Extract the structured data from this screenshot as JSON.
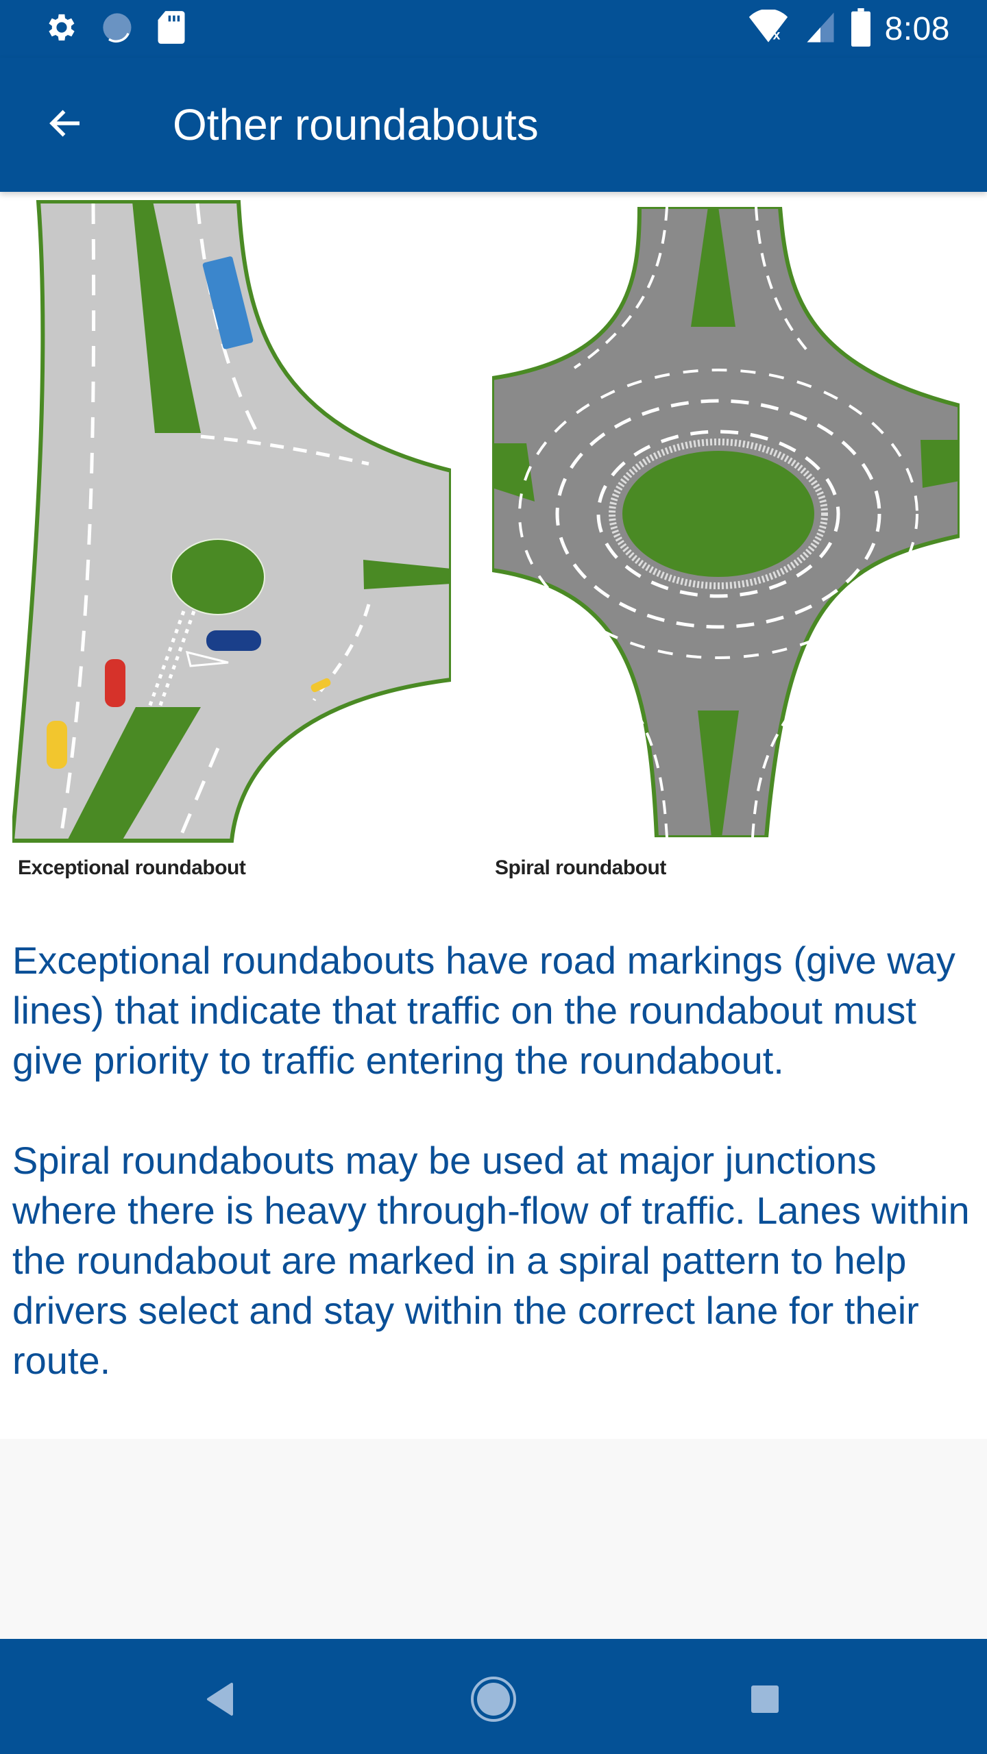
{
  "status_bar": {
    "left_icons": [
      "gear-icon",
      "sync-progress-icon",
      "sd-card-icon"
    ],
    "right_icons": [
      "wifi-off-icon",
      "cell-signal-icon",
      "battery-icon"
    ],
    "time": "8:08"
  },
  "app_bar": {
    "back_icon": "arrow-back-icon",
    "title": "Other roundabouts"
  },
  "figure": {
    "left_caption": "Exceptional roundabout",
    "right_caption": "Spiral roundabout"
  },
  "body": {
    "paragraphs": [
      "Exceptional roundabouts have road markings (give way lines) that indicate that traffic on the roundabout must give priority to traffic entering the roundabout.",
      "Spiral roundabouts may be used at major junctions where there is heavy through-flow of traffic. Lanes within the roundabout are marked in a spiral pattern to help drivers select and stay within the correct lane for their route."
    ]
  },
  "nav_bar": {
    "back": "nav-back-icon",
    "home": "nav-home-icon",
    "recents": "nav-recents-icon"
  },
  "colors": {
    "primary": "#045196",
    "body_text": "#0a4f97",
    "grass": "#4a8a24",
    "road_light": "#c8c8c8",
    "road_dark": "#8a8a8a"
  }
}
